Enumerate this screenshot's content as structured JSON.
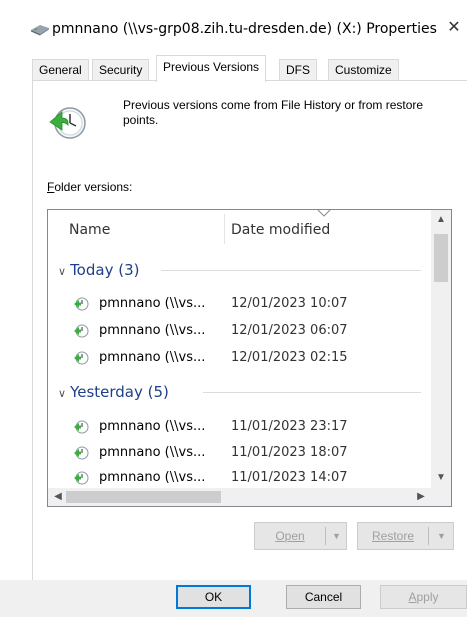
{
  "window": {
    "title": "pmnnano (\\\\vs-grp08.zih.tu-dresden.de) (X:) Properties",
    "close_symbol": "✕"
  },
  "tabs": [
    {
      "label": "General",
      "active": false
    },
    {
      "label": "Security",
      "active": false
    },
    {
      "label": "Previous Versions",
      "active": true
    },
    {
      "label": "DFS",
      "active": false
    },
    {
      "label": "Customize",
      "active": false
    }
  ],
  "info": {
    "icon": "file-history-clock-icon",
    "text": "Previous versions come from File History or from restore points."
  },
  "folder_versions": {
    "label_first": "F",
    "label_rest": "older versions:",
    "columns": {
      "name": "Name",
      "date": "Date modified"
    },
    "groups": [
      {
        "title": "Today (3)",
        "items": [
          {
            "name": "pmnnano (\\\\vs...",
            "date": "12/01/2023 10:07"
          },
          {
            "name": "pmnnano (\\\\vs...",
            "date": "12/01/2023 06:07"
          },
          {
            "name": "pmnnano (\\\\vs...",
            "date": "12/01/2023 02:15"
          }
        ]
      },
      {
        "title": "Yesterday (5)",
        "items": [
          {
            "name": "pmnnano (\\\\vs...",
            "date": "11/01/2023 23:17"
          },
          {
            "name": "pmnnano (\\\\vs...",
            "date": "11/01/2023 18:07"
          },
          {
            "name": "pmnnano (\\\\vs...",
            "date": "11/01/2023 14:07"
          }
        ]
      }
    ]
  },
  "actions": {
    "open_first": "O",
    "open_rest": "pen",
    "restore_first": "R",
    "restore_rest": "estore"
  },
  "footer": {
    "ok": "OK",
    "cancel": "Cancel",
    "apply_first": "A",
    "apply_rest": "pply"
  },
  "colors": {
    "group_header": "#1e3f8a",
    "accent": "#0078d7",
    "disabled_text": "#a0a0a0"
  }
}
